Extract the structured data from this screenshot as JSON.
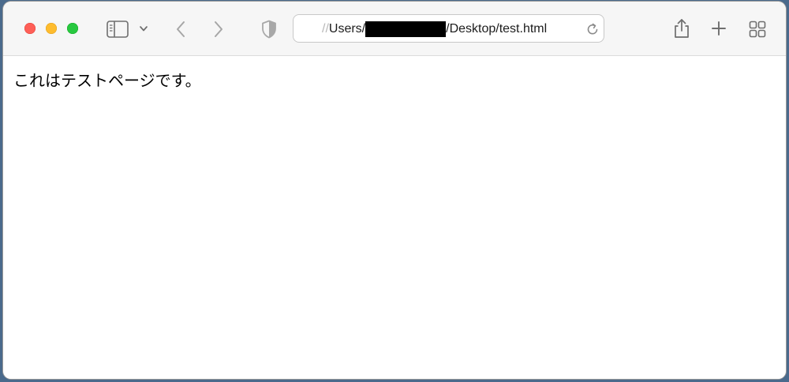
{
  "window": {
    "traffic_lights": {
      "close": "#fe5f57",
      "minimize": "#febc2e",
      "zoom": "#28c840"
    }
  },
  "toolbar": {
    "icons": [
      "sidebar-icon",
      "chevron-down-icon",
      "back-arrow-icon",
      "forward-arrow-icon",
      "privacy-shield-icon",
      "reload-icon",
      "share-icon",
      "new-tab-plus-icon",
      "tab-overview-icon"
    ]
  },
  "address_bar": {
    "url_faded_prefix": "//",
    "url_user_prefix": "Users/",
    "url_redacted": true,
    "url_suffix": "/Desktop/test.html"
  },
  "page": {
    "body_text": "これはテストページです。"
  }
}
